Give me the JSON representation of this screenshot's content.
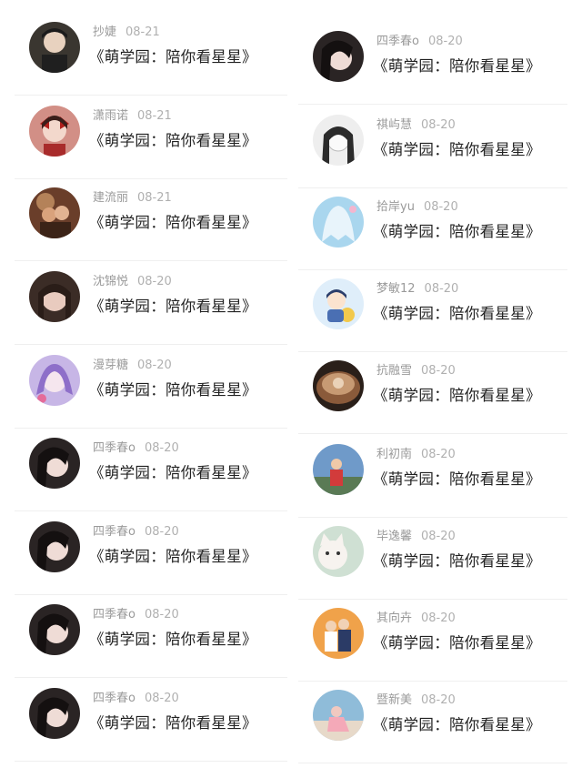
{
  "title_text": "《萌学园：陪你看星星》",
  "left_items": [
    {
      "name": "抄婕",
      "date": "08-21",
      "avatar": "avatar-dark-hair-man",
      "bg": "#3a3630",
      "fg": "#e8d2bf"
    },
    {
      "name": "潇雨诺",
      "date": "08-21",
      "avatar": "avatar-girl-red-bow",
      "bg": "#d28f86",
      "fg": "#f3d8cc"
    },
    {
      "name": "建流丽",
      "date": "08-21",
      "avatar": "avatar-couple-warm",
      "bg": "#6a3e2a",
      "fg": "#e6b07a"
    },
    {
      "name": "沈锦悦",
      "date": "08-20",
      "avatar": "avatar-girl-bangs",
      "bg": "#3b2c26",
      "fg": "#e9cbbf"
    },
    {
      "name": "漫芽糖",
      "date": "08-20",
      "avatar": "avatar-anime-purple",
      "bg": "#c7b6e6",
      "fg": "#8e6fc9"
    },
    {
      "name": "四季春o",
      "date": "08-20",
      "avatar": "avatar-girl-dark-hair",
      "bg": "#2a2424",
      "fg": "#efdcd6"
    },
    {
      "name": "四季春o",
      "date": "08-20",
      "avatar": "avatar-girl-dark-hair",
      "bg": "#2a2424",
      "fg": "#efdcd6"
    },
    {
      "name": "四季春o",
      "date": "08-20",
      "avatar": "avatar-girl-dark-hair",
      "bg": "#2a2424",
      "fg": "#efdcd6"
    },
    {
      "name": "四季春o",
      "date": "08-20",
      "avatar": "avatar-girl-dark-hair",
      "bg": "#2a2424",
      "fg": "#efdcd6"
    }
  ],
  "right_items": [
    {
      "name": "四季春o",
      "date": "08-20",
      "avatar": "avatar-girl-dark-hair",
      "bg": "#2a2424",
      "fg": "#efdcd6"
    },
    {
      "name": "祺屿慧",
      "date": "08-20",
      "avatar": "avatar-sketch-girl",
      "bg": "#eeeeee",
      "fg": "#2b2b2b"
    },
    {
      "name": "拾岸yu",
      "date": "08-20",
      "avatar": "avatar-anime-blue",
      "bg": "#a9d6ee",
      "fg": "#ffffff"
    },
    {
      "name": "梦敏12",
      "date": "08-20",
      "avatar": "avatar-cartoon-boy",
      "bg": "#dfeefa",
      "fg": "#f2c94c"
    },
    {
      "name": "抗融雪",
      "date": "08-20",
      "avatar": "avatar-latte-art",
      "bg": "#2a1f19",
      "fg": "#c79a73"
    },
    {
      "name": "利初南",
      "date": "08-20",
      "avatar": "avatar-boy-red-shirt",
      "bg": "#6f9ac9",
      "fg": "#d23b3b"
    },
    {
      "name": "毕逸馨",
      "date": "08-20",
      "avatar": "avatar-white-cat",
      "bg": "#cfe0d3",
      "fg": "#f7f3ef"
    },
    {
      "name": "其向卉",
      "date": "08-20",
      "avatar": "avatar-couple-orange",
      "bg": "#f0a24a",
      "fg": "#2b3b66"
    },
    {
      "name": "暨新美",
      "date": "08-20",
      "avatar": "avatar-girl-sitting",
      "bg": "#8fbcd9",
      "fg": "#f1c9c0"
    }
  ]
}
